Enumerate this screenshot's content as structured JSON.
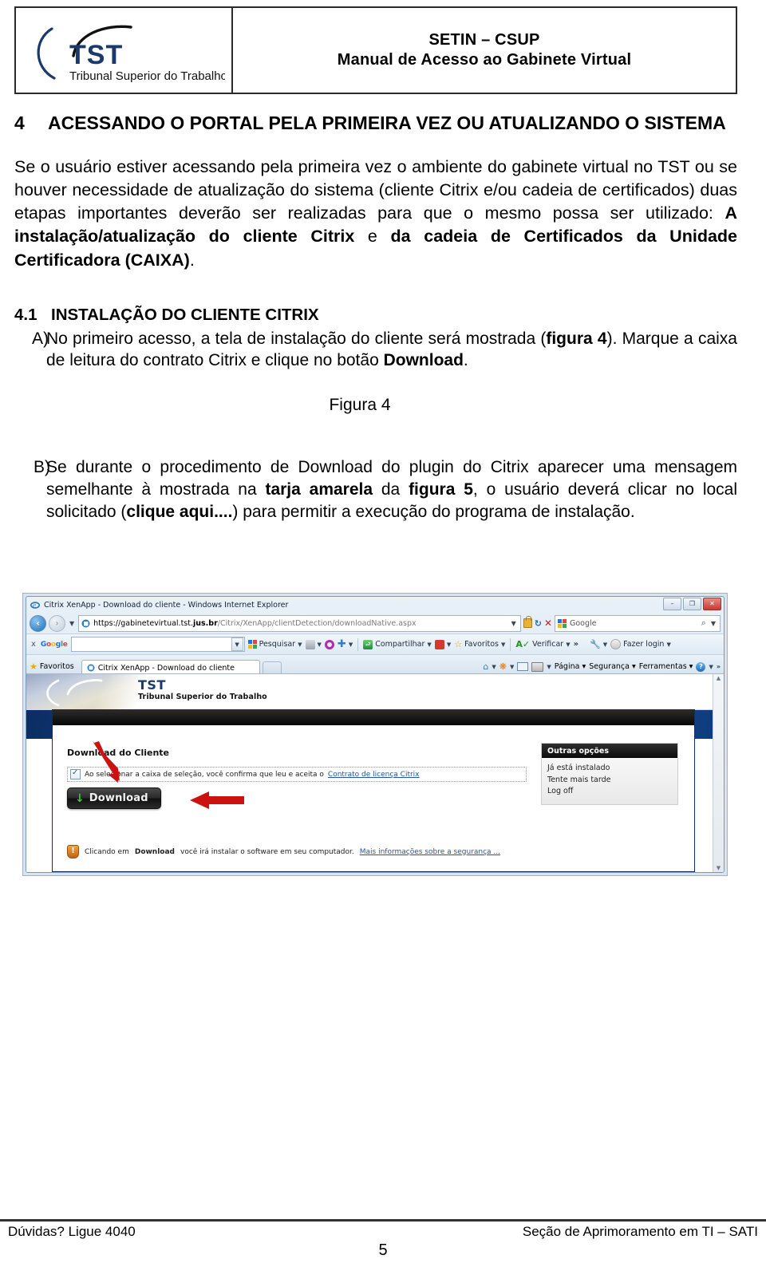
{
  "header": {
    "logo": {
      "acronym": "TST",
      "subtitle": "Tribunal Superior do Trabalho"
    },
    "line1": "SETIN – CSUP",
    "line2": "Manual de Acesso ao Gabinete Virtual"
  },
  "section": {
    "number": "4",
    "title": "ACESSANDO O PORTAL PELA PRIMEIRA VEZ OU ATUALIZANDO O SISTEMA",
    "paragraph_plain_1": "Se o usuário estiver acessando pela primeira vez o ambiente do gabinete virtual no TST ou se houver necessidade de atualização do sistema (cliente Citrix e/ou cadeia de certificados) duas etapas importantes deverão ser realizadas para que o mesmo possa ser utilizado: ",
    "paragraph_bold_1": "A instalação/atualização do cliente Citrix",
    "paragraph_plain_2": " e ",
    "paragraph_bold_2": "da cadeia de Certificados da Unidade Certificadora (CAIXA)",
    "paragraph_plain_3": "."
  },
  "subsection": {
    "number": "4.1",
    "title": "INSTALAÇÃO DO CLIENTE CITRIX",
    "item_a": {
      "marker": "A)",
      "text_1": "No primeiro acesso, a tela de instalação do cliente será mostrada (",
      "bold_1": "figura 4",
      "text_2": "). Marque a caixa de leitura do contrato Citrix e clique no botão ",
      "bold_2": "Download",
      "text_3": "."
    },
    "item_b": {
      "marker": "B)",
      "text_1": "Se durante o procedimento de Download do plugin do Citrix aparecer uma mensagem semelhante à mostrada na ",
      "bold_1": "tarja amarela",
      "text_2": " da ",
      "bold_2": "figura 5",
      "text_3": ", o usuário deverá clicar no local solicitado (",
      "bold_3": "clique aqui....",
      "text_4": ") para permitir a execução do programa de instalação."
    }
  },
  "figure": {
    "caption": "Figura 4",
    "browser": {
      "window_title": "Citrix XenApp - Download do cliente - Windows Internet Explorer",
      "url_scheme": "https://",
      "url_prefix": "gabinetevirtual.tst.",
      "url_domain": "jus.br",
      "url_path": "/Citrix/XenApp/clientDetection/downloadNative.aspx",
      "search_placeholder": "Google",
      "window_controls": {
        "minimize": "–",
        "restore": "❐",
        "close": "✕"
      },
      "google_toolbar": {
        "brand": "Google",
        "close_label": "x",
        "search_value": "",
        "buttons": [
          {
            "label": "Pesquisar"
          },
          {
            "label": "Compartilhar"
          },
          {
            "label": "Favoritos"
          },
          {
            "label": "Verificar"
          },
          {
            "label": "Fazer login"
          }
        ],
        "overflow": "»"
      },
      "favorites_label": "Favoritos",
      "tab_label": "Citrix XenApp - Download do cliente",
      "command_bar": [
        {
          "label": "Página"
        },
        {
          "label": "Segurança"
        },
        {
          "label": "Ferramentas"
        }
      ],
      "command_overflow": "»"
    },
    "page": {
      "banner": {
        "acronym": "TST",
        "subtitle": "Tribunal Superior do Trabalho"
      },
      "download_title": "Download do Cliente",
      "checkbox_text": "Ao selecionar a caixa de seleção, você confirma que leu e aceita o ",
      "checkbox_link": "Contrato de licença Citrix",
      "download_button": "Download",
      "security_note_1": "Clicando em ",
      "security_note_bold": "Download",
      "security_note_2": " você irá instalar o software em seu computador. ",
      "security_note_link": "Mais informações sobre a segurança ...",
      "other_options": {
        "title": "Outras opções",
        "items": [
          "Já está instalado",
          "Tente mais tarde",
          "Log off"
        ]
      }
    }
  },
  "footer": {
    "left": "Dúvidas? Ligue 4040",
    "right": "Seção de Aprimoramento em TI – SATI",
    "page_number": "5"
  },
  "colors": {
    "logo_navy": "#1b3a6b",
    "band_blue": "#12498f",
    "link_blue": "#2155a8",
    "annotation_red": "#cc1111",
    "download_green": "#3fc43f"
  }
}
